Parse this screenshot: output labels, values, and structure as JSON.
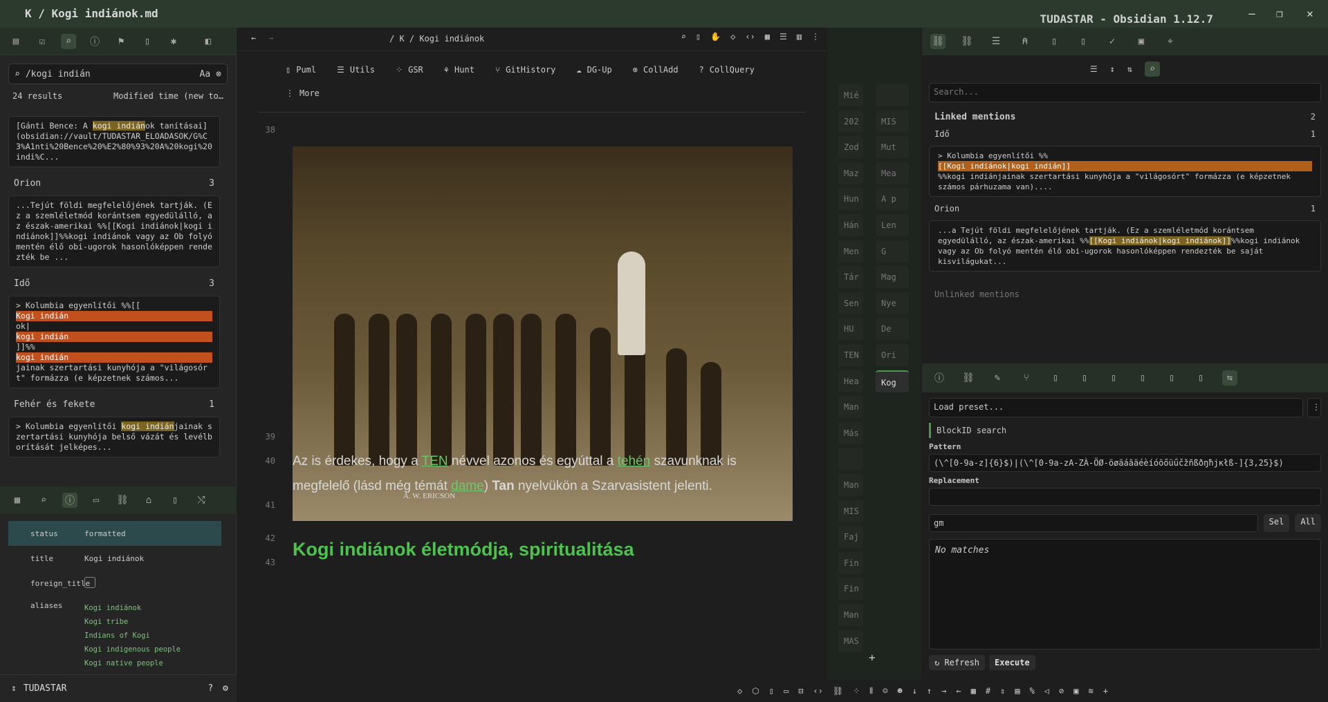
{
  "window": {
    "title": "K / Kogi indiánok.md",
    "app_title": "TUDASTAR - Obsidian 1.12.7"
  },
  "search": {
    "query": "/kogi indián",
    "case_label": "Aa",
    "results_count": "24 results",
    "sort": "Modified time (new to…"
  },
  "results": [
    {
      "title": "",
      "count": "",
      "text_before": "[Gánti Bence: A ",
      "hl": "kogi indián",
      "text_after": "ok tanításai](obsidian://vault/TUDASTAR_ELOADASOK/G%C3%A1nti%20Bence%20%E2%80%93%20A%20kogi%20indi%C..."
    },
    {
      "title": "Orion",
      "count": "3",
      "text": "...Tejút földi megfelelőjének tartják. (Ez a szemléletmód korántsem egyedülálló, az észak-amerikai %%[[Kogi indiánok|kogi indiánok]]%%kogi indiánok vagy az Ob folyó mentén élő obi-ugorok hasonlóképpen rendezték be ..."
    },
    {
      "title": "Idő",
      "count": "3",
      "line1": "> Kolumbia egyenlítői %%[[",
      "hl1": "Kogi indián",
      "mid": "ok|",
      "hl2": "kogi indián",
      "end": "]]%%",
      "hl3": "kogi indián",
      "tail": "jainak szertartási kunyhója a \"világosórt\" formázza (e képzetnek számos..."
    },
    {
      "title": "Fehér és fekete",
      "count": "1",
      "text_before": "> Kolumbia egyenlítői ",
      "hl": "kogi indián",
      "text_after": "jainak szertartási kunyhója belső vázát és levélborítását jelképes..."
    }
  ],
  "properties": [
    {
      "key": "status",
      "value": "formatted"
    },
    {
      "key": "title",
      "value": "Kogi indiánok"
    },
    {
      "key": "foreign_title",
      "value": ""
    },
    {
      "key": "aliases",
      "values": [
        "Kogi indiánok",
        "Kogi tribe",
        "Indians of Kogi",
        "Kogi indigenous people",
        "Kogi native people"
      ]
    }
  ],
  "vault": {
    "name": "TUDASTAR"
  },
  "editor": {
    "breadcrumb": "/ K / Kogi indiánok",
    "commands": [
      "Puml",
      "Utils",
      "GSR",
      "Hunt",
      "GitHistory",
      "DG-Up",
      "CollAdd",
      "CollQuery",
      "More"
    ],
    "lines": {
      "l38": "38",
      "l39": "39",
      "l40": "40",
      "l41": "41",
      "l42": "42",
      "l43": "43"
    },
    "photo_caption": "A. W. ERICSON",
    "p1_a": "Az is érdekes, hogy a ",
    "p1_l1": "TEN",
    "p1_b": " névvel azonos és egyúttal a ",
    "p1_l2": "tehén",
    "p1_c": " szavunknak is",
    "p2_a": "megfelelő (lásd még témát ",
    "p2_l": "dame",
    "p2_b": ") ",
    "p2_bold": "Tan",
    "p2_c": " nyelvükön a Szarvasistent jelenti.",
    "heading": "Kogi indiánok életmódja, spiritualitása"
  },
  "midcol": {
    "left": [
      "Mié",
      "202",
      "Zod",
      "Maz",
      "Hun",
      "Hán",
      "Men",
      "Tár",
      "Sen",
      "HU",
      "TEN",
      "Hea",
      "Man",
      "Más",
      "",
      "Man",
      "MIS",
      "Faj",
      "Fin",
      "Fin",
      "Man",
      "MAS"
    ],
    "right": [
      "",
      "MIS",
      "Mut",
      "Mea",
      "A p",
      "Len",
      "G",
      "Mag",
      "Nye",
      "De",
      "Ori",
      "Kog"
    ]
  },
  "backlinks": {
    "search_placeholder": "Search...",
    "linked_title": "Linked mentions",
    "linked_count": "2",
    "groups": [
      {
        "title": "Idő",
        "count": "1",
        "pre": "> Kolumbia egyenlítői %%",
        "hl": "[[Kogi indiánok|kogi indián]]",
        "post": "%%kogi indiánjainak szertartási kunyhója a \"világosórt\" formázza (e képzetnek számos párhuzama van)...."
      },
      {
        "title": "Orion",
        "count": "1",
        "pre": "...a Tejút földi megfelelőjének tartják. (Ez a szemléletmód korántsem egyedülálló, az észak-amerikai %%",
        "hl": "[[Kogi indiánok|kogi indiánok]]",
        "post": "%%kogi indiánok vagy az Ob folyó mentén élő obi-ugorok hasonlóképpen rendezték be saját kisvilágukat..."
      }
    ],
    "unlinked": "Unlinked mentions"
  },
  "regex": {
    "preset": "Load preset...",
    "name": "BlockID search",
    "pattern_label": "Pattern",
    "pattern": "(\\^[0-9a-z]{6}$)|(\\^[0-9a-zA-ZÀ-ÖØ-öøäáãäéèíóöőüűčžñßðŋħjĸłß-]{3,25}$)",
    "replacement_label": "Replacement",
    "replacement": "",
    "flags": "gm",
    "sel": "Sel",
    "all": "All",
    "result": "No matches",
    "refresh": "Refresh",
    "execute": "Execute"
  }
}
